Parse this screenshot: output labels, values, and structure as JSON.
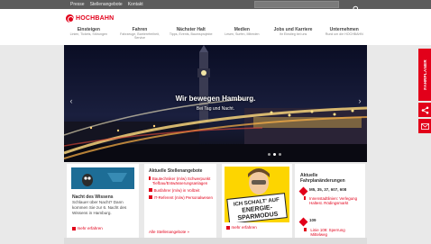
{
  "topbar": {
    "links": [
      "Presse",
      "Stellenangebote",
      "Kontakt"
    ],
    "search_placeholder": "Suchen"
  },
  "logo": {
    "name": "HOCHBAHN"
  },
  "nav": [
    {
      "title": "Einsteigen",
      "sub": "Linien, Tickets, Störungen"
    },
    {
      "title": "Fahren",
      "sub": "Fahrzeuge, Barrierefreiheit, Service"
    },
    {
      "title": "Nächster Halt",
      "sub": "Tipps, Events, Baumsprojekte"
    },
    {
      "title": "Medien",
      "sub": "Lesen, Surfen, Mitreden"
    },
    {
      "title": "Jobs und Karriere",
      "sub": "Ihr Einstieg bei uns"
    },
    {
      "title": "Unternehmen",
      "sub": "Rund um die HOCHBAHN"
    }
  ],
  "hero": {
    "title": "Wir bewegen Hamburg.",
    "subtitle": "Bei Tag und Nacht.",
    "prev": "‹",
    "next": "›"
  },
  "cards": {
    "night": {
      "heading": "Nacht des Wissens",
      "text": "Schlauer über Nacht? Dann kommen Sie zur 6. Nacht des Wissens in Hamburg.",
      "more": "mehr erfahren"
    },
    "jobs": {
      "heading": "Aktuelle Stellenangebote",
      "items": [
        "Bautechniker (m/w) Schwerpunkt Tiefbau/Entwässerungsanlagen",
        "Busfahrer (m/w) in Vollzeit",
        "IT-Referent (m/w) Personalwesen"
      ],
      "more": "Alle Stellenangebote »"
    },
    "promo": {
      "sign_line1": "ICH SCHALT' AUF",
      "sign_line2": "ENERGIE-",
      "sign_line3": "SPARMODUS",
      "more": "mehr erfahren"
    },
    "changes": {
      "heading": "Aktuelle Fahrplanänderungen",
      "group1_lines": "M5, 35, 37, 607, 608",
      "group1_info": "Innenstadtlinien: Verlegung Haltest. Rödingsmarkt",
      "group2_lines": "109",
      "group2_info": "Linie 109: Sperrung Mittelweg"
    }
  },
  "sidebar": {
    "fahrplaner": "FAHRPLANER",
    "share": "share",
    "mail": "mail"
  },
  "colors": {
    "brand_red": "#e2001a"
  }
}
